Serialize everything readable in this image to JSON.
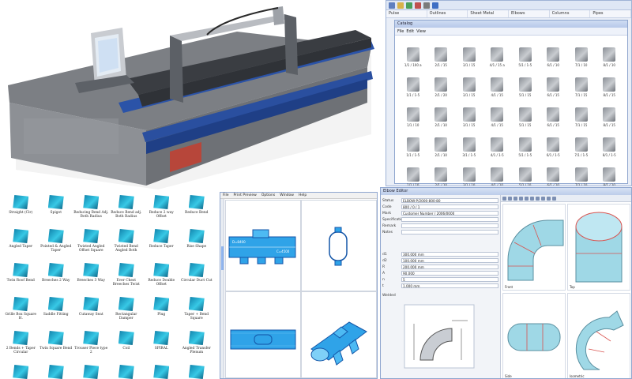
{
  "catalog": {
    "menu": [
      "Pulse",
      "Outlines",
      "Sheet Metal",
      "Elbows",
      "Columns",
      "Pipes"
    ],
    "window_title": "Catalog",
    "toolbar": [
      "File",
      "Edit",
      "View"
    ],
    "items": [
      {
        "label": "1/1 / 100 a"
      },
      {
        "label": "2/1 / 15"
      },
      {
        "label": "3/1 / 15"
      },
      {
        "label": "4/1 / 15 a"
      },
      {
        "label": "5/1 / 1-5"
      },
      {
        "label": "6/1 / 10"
      },
      {
        "label": "7/1 / 10"
      },
      {
        "label": "8/1 / 10"
      },
      {
        "label": "1/1 / 1-5"
      },
      {
        "label": "2/1 / 20"
      },
      {
        "label": "3/1 / 15"
      },
      {
        "label": "4/1 / 15"
      },
      {
        "label": "5/1 / 15"
      },
      {
        "label": "6/1 / 15"
      },
      {
        "label": "7/1 / 15"
      },
      {
        "label": "8/1 / 15"
      },
      {
        "label": "1/1 / 10"
      },
      {
        "label": "2/1 / 10"
      },
      {
        "label": "3/1 / 15"
      },
      {
        "label": "4/1 / 15"
      },
      {
        "label": "5/1 / 15"
      },
      {
        "label": "6/1 / 15"
      },
      {
        "label": "7/1 / 15"
      },
      {
        "label": "8/1 / 15"
      },
      {
        "label": "1/1 / 1-5"
      },
      {
        "label": "2/1 / 10"
      },
      {
        "label": "3/1 / 1-5"
      },
      {
        "label": "4/1 / 1-5"
      },
      {
        "label": "5/1 / 1-5"
      },
      {
        "label": "6/1 / 1-5"
      },
      {
        "label": "7/1 / 1-5"
      },
      {
        "label": "8/1 / 1-5"
      },
      {
        "label": "1/1 / 10"
      },
      {
        "label": "2/1 / 10"
      },
      {
        "label": "3/1 / 10"
      },
      {
        "label": "4/1 / 10"
      },
      {
        "label": "5/1 / 10"
      },
      {
        "label": "6/1 / 10"
      },
      {
        "label": "7/1 / 10"
      },
      {
        "label": "8/1 / 10"
      }
    ]
  },
  "components": [
    {
      "label": "Straight (Cir)"
    },
    {
      "label": "Spigot"
    },
    {
      "label": "Reducing Bend Adj. Both Radius"
    },
    {
      "label": "Reduce Bend adj. Both Radius"
    },
    {
      "label": "Reduce 2 way Offset"
    },
    {
      "label": "Reduce Bend"
    },
    {
      "label": "Angled Taper"
    },
    {
      "label": "Pointed & Angled Taper"
    },
    {
      "label": "Twisted Angled Offset Square"
    },
    {
      "label": "Twisted Bend Angled Both"
    },
    {
      "label": "Reduce Taper"
    },
    {
      "label": "Rise Shape"
    },
    {
      "label": "Twin Roof Bend"
    },
    {
      "label": "Breeches 2 Way"
    },
    {
      "label": "Breeches 3 Way"
    },
    {
      "label": "Ever Chest Breeches Twist"
    },
    {
      "label": "Reduce Double Offset"
    },
    {
      "label": "Circular Duct Cut"
    },
    {
      "label": "Grille Box Square H."
    },
    {
      "label": "Saddle Fitting"
    },
    {
      "label": "Cutaway Seat"
    },
    {
      "label": "Rectangular Damper"
    },
    {
      "label": "Plug"
    },
    {
      "label": "Taper + Bend Square"
    },
    {
      "label": "2 Bends + Taper Circular"
    },
    {
      "label": "Twin Square Bend"
    },
    {
      "label": "Trouser Piece type 2"
    },
    {
      "label": "Coil"
    },
    {
      "label": "SPIRAL"
    },
    {
      "label": "Angled Transfer Plenum"
    },
    {
      "label": "Tray with Holes"
    },
    {
      "label": "Grille Box Sq. + Outlet"
    },
    {
      "label": "Transition Handle"
    },
    {
      "label": "Roof with Tee type 2"
    },
    {
      "label": "Straight Oval Variant"
    },
    {
      "label": "Cabinet Straight"
    }
  ],
  "cad": {
    "menu": [
      "File",
      "Print Preview",
      "Options",
      "Window",
      "Help"
    ],
    "dim_labels": [
      "C=4500",
      "D=8400"
    ]
  },
  "elbow": {
    "title": "Elbow Editor",
    "fields": [
      {
        "k": "Status",
        "v": "ELBOW-P/2000-800-80"
      },
      {
        "k": "Code",
        "v": "800 / 0 / 1"
      },
      {
        "k": "Mark",
        "v": "Customer Number / 2006/0000"
      },
      {
        "k": "Specification",
        "v": ""
      },
      {
        "k": "Remark",
        "v": ""
      },
      {
        "k": "Notes",
        "v": ""
      }
    ],
    "dims": [
      {
        "k": "d1",
        "v": "300.000 mm"
      },
      {
        "k": "d2",
        "v": "100.000 mm"
      },
      {
        "k": "R",
        "v": "200.000 mm"
      },
      {
        "k": "A",
        "v": "90.000"
      },
      {
        "k": "n",
        "v": "5"
      },
      {
        "k": "t",
        "v": "1.000 mm"
      }
    ],
    "section": "Welded",
    "views": [
      "Front",
      "Top",
      "Side",
      "Isometric"
    ]
  }
}
